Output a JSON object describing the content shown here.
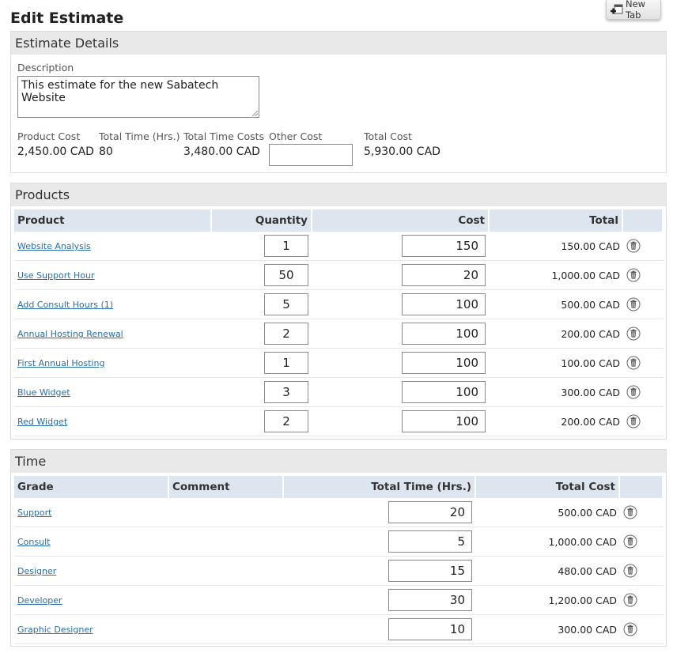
{
  "page": {
    "title": "Edit Estimate"
  },
  "new_tab": {
    "label": "New Tab",
    "icon": "new-tab-icon"
  },
  "estimate_details": {
    "heading": "Estimate Details",
    "description_label": "Description",
    "description_value": "This estimate for the new Sabatech Website",
    "product_cost_label": "Product Cost",
    "product_cost_value": "2,450.00 CAD",
    "total_time_label": "Total Time (Hrs.)",
    "total_time_value": "80",
    "total_time_costs_label": "Total Time Costs",
    "total_time_costs_value": "3,480.00 CAD",
    "other_cost_label": "Other Cost",
    "other_cost_value": "",
    "total_cost_label": "Total Cost",
    "total_cost_value": "5,930.00 CAD"
  },
  "products": {
    "heading": "Products",
    "columns": [
      "Product",
      "Quantity",
      "Cost",
      "Total"
    ],
    "rows": [
      {
        "product": "Website Analysis",
        "quantity": "1",
        "cost": "150",
        "total": "150.00 CAD"
      },
      {
        "product": "Use Support Hour",
        "quantity": "50",
        "cost": "20",
        "total": "1,000.00 CAD"
      },
      {
        "product": "Add Consult Hours (1)",
        "quantity": "5",
        "cost": "100",
        "total": "500.00 CAD"
      },
      {
        "product": "Annual Hosting Renewal",
        "quantity": "2",
        "cost": "100",
        "total": "200.00 CAD"
      },
      {
        "product": "First Annual Hosting",
        "quantity": "1",
        "cost": "100",
        "total": "100.00 CAD"
      },
      {
        "product": "Blue Widget",
        "quantity": "3",
        "cost": "100",
        "total": "300.00 CAD"
      },
      {
        "product": "Red Widget",
        "quantity": "2",
        "cost": "100",
        "total": "200.00 CAD"
      }
    ]
  },
  "time": {
    "heading": "Time",
    "columns": [
      "Grade",
      "Comment",
      "Total Time (Hrs.)",
      "Total Cost"
    ],
    "rows": [
      {
        "grade": "Support",
        "comment": "",
        "hours": "20",
        "cost": "500.00 CAD"
      },
      {
        "grade": "Consult",
        "comment": "",
        "hours": "5",
        "cost": "1,000.00 CAD"
      },
      {
        "grade": "Designer",
        "comment": "",
        "hours": "15",
        "cost": "480.00 CAD"
      },
      {
        "grade": "Developer",
        "comment": "",
        "hours": "30",
        "cost": "1,200.00 CAD"
      },
      {
        "grade": "Graphic Designer",
        "comment": "",
        "hours": "10",
        "cost": "300.00 CAD"
      }
    ]
  },
  "colors": {
    "link": "#2a6ea6",
    "header_bg": "#dde6ef",
    "section_bg": "#e9e9e9"
  },
  "icons": {
    "delete": "trash-icon"
  }
}
